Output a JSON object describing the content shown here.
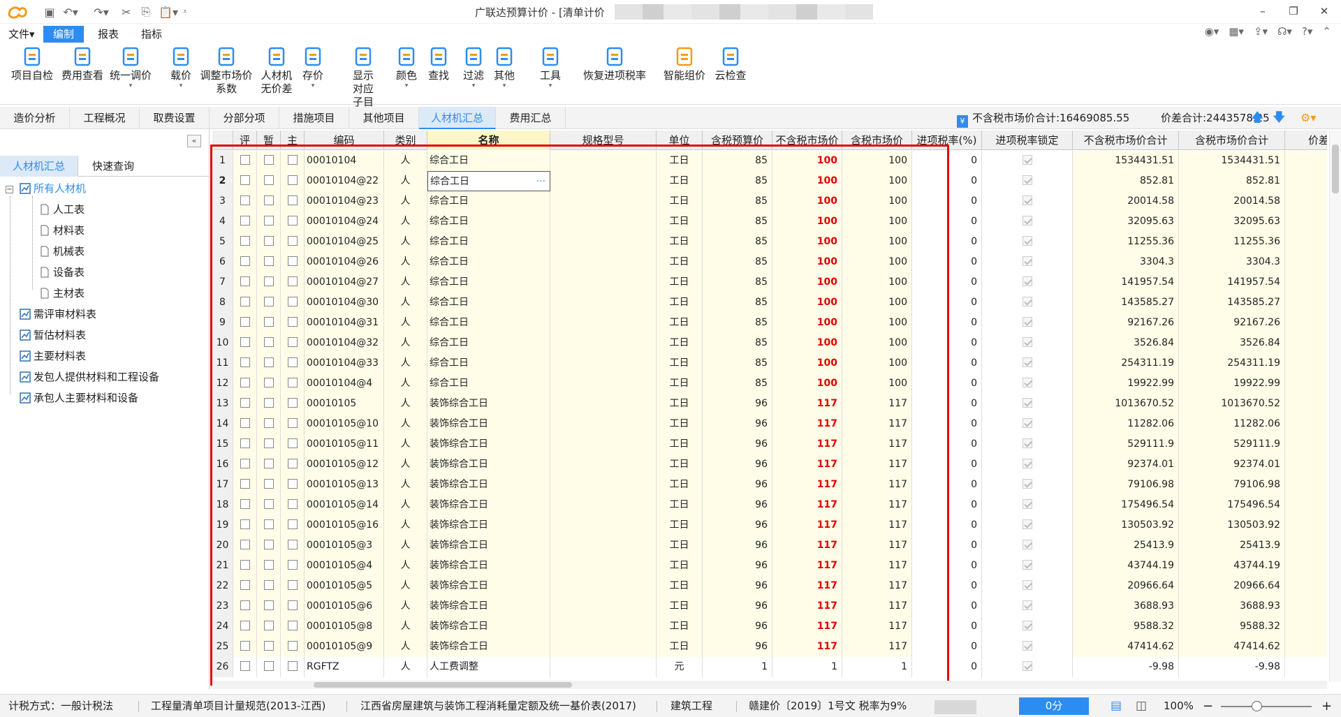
{
  "app": {
    "title": "广联达预算计价 - [清单计价"
  },
  "menu": [
    "文件",
    "编制",
    "报表",
    "指标"
  ],
  "ribbon": [
    {
      "label": "项目自检",
      "icon": "check-icon"
    },
    {
      "label": "费用查看",
      "icon": "cost-view-icon"
    },
    {
      "label": "统一调价",
      "icon": "adjust-price-icon"
    },
    {
      "label": "载价",
      "icon": "load-price-icon"
    },
    {
      "label": "调整市场价",
      "label2": "系数",
      "icon": "market-coef-icon"
    },
    {
      "label": "人材机",
      "label2": "无价差",
      "icon": "scale-icon"
    },
    {
      "label": "存价",
      "icon": "save-price-icon"
    },
    {
      "label": "显示",
      "label2": "对应子目",
      "icon": "show-sub-icon"
    },
    {
      "label": "颜色",
      "icon": "paint-icon"
    },
    {
      "label": "查找",
      "icon": "binoculars-icon"
    },
    {
      "label": "过滤",
      "icon": "filter-icon"
    },
    {
      "label": "其他",
      "icon": "grid-icon"
    },
    {
      "label": "工具",
      "icon": "tool-icon"
    },
    {
      "label": "恢复进项税率",
      "icon": "tax-rate-icon"
    },
    {
      "label": "智能组价",
      "icon": "smart-price-icon"
    },
    {
      "label": "云检查",
      "icon": "cloud-check-icon"
    }
  ],
  "tabs": [
    "造价分析",
    "工程概况",
    "取费设置",
    "分部分项",
    "措施项目",
    "其他项目",
    "人材机汇总",
    "费用汇总"
  ],
  "summary": {
    "no_tax_total": "不含税市场价合计:16469085.55",
    "diff_total": "价差合计:2443578.25"
  },
  "left": {
    "tabs": [
      "人材机汇总",
      "快速查询"
    ],
    "tree": [
      {
        "label": "所有人材机",
        "level": 0
      },
      {
        "label": "人工表",
        "level": 1
      },
      {
        "label": "材料表",
        "level": 1
      },
      {
        "label": "机械表",
        "level": 1
      },
      {
        "label": "设备表",
        "level": 1
      },
      {
        "label": "主材表",
        "level": 1
      },
      {
        "label": "需评审材料表",
        "level": 0
      },
      {
        "label": "暂估材料表",
        "level": 0
      },
      {
        "label": "主要材料表",
        "level": 0
      },
      {
        "label": "发包人提供材料和工程设备",
        "level": 0
      },
      {
        "label": "承包人主要材料和设备",
        "level": 0
      }
    ]
  },
  "grid": {
    "headers": [
      "",
      "评",
      "暂",
      "主",
      "编码",
      "类别",
      "名称",
      "规格型号",
      "单位",
      "含税预算价",
      "不含税市场价",
      "含税市场价",
      "进项税率(%)",
      "进项税率锁定",
      "不含税市场价合计",
      "含税市场价合计",
      "价差"
    ],
    "rows": [
      [
        "1",
        "00010104",
        "人",
        "综合工日",
        "工日",
        "85",
        "100",
        "100",
        "0",
        "1534431.51",
        "1534431.51"
      ],
      [
        "2",
        "00010104@22",
        "人",
        "综合工日",
        "工日",
        "85",
        "100",
        "100",
        "0",
        "852.81",
        "852.81"
      ],
      [
        "3",
        "00010104@23",
        "人",
        "综合工日",
        "工日",
        "85",
        "100",
        "100",
        "0",
        "20014.58",
        "20014.58"
      ],
      [
        "4",
        "00010104@24",
        "人",
        "综合工日",
        "工日",
        "85",
        "100",
        "100",
        "0",
        "32095.63",
        "32095.63"
      ],
      [
        "5",
        "00010104@25",
        "人",
        "综合工日",
        "工日",
        "85",
        "100",
        "100",
        "0",
        "11255.36",
        "11255.36"
      ],
      [
        "6",
        "00010104@26",
        "人",
        "综合工日",
        "工日",
        "85",
        "100",
        "100",
        "0",
        "3304.3",
        "3304.3"
      ],
      [
        "7",
        "00010104@27",
        "人",
        "综合工日",
        "工日",
        "85",
        "100",
        "100",
        "0",
        "141957.54",
        "141957.54"
      ],
      [
        "8",
        "00010104@30",
        "人",
        "综合工日",
        "工日",
        "85",
        "100",
        "100",
        "0",
        "143585.27",
        "143585.27"
      ],
      [
        "9",
        "00010104@31",
        "人",
        "综合工日",
        "工日",
        "85",
        "100",
        "100",
        "0",
        "92167.26",
        "92167.26"
      ],
      [
        "10",
        "00010104@32",
        "人",
        "综合工日",
        "工日",
        "85",
        "100",
        "100",
        "0",
        "3526.84",
        "3526.84"
      ],
      [
        "11",
        "00010104@33",
        "人",
        "综合工日",
        "工日",
        "85",
        "100",
        "100",
        "0",
        "254311.19",
        "254311.19"
      ],
      [
        "12",
        "00010104@4",
        "人",
        "综合工日",
        "工日",
        "85",
        "100",
        "100",
        "0",
        "19922.99",
        "19922.99"
      ],
      [
        "13",
        "00010105",
        "人",
        "装饰综合工日",
        "工日",
        "96",
        "117",
        "117",
        "0",
        "1013670.52",
        "1013670.52"
      ],
      [
        "14",
        "00010105@10",
        "人",
        "装饰综合工日",
        "工日",
        "96",
        "117",
        "117",
        "0",
        "11282.06",
        "11282.06"
      ],
      [
        "15",
        "00010105@11",
        "人",
        "装饰综合工日",
        "工日",
        "96",
        "117",
        "117",
        "0",
        "529111.9",
        "529111.9"
      ],
      [
        "16",
        "00010105@12",
        "人",
        "装饰综合工日",
        "工日",
        "96",
        "117",
        "117",
        "0",
        "92374.01",
        "92374.01"
      ],
      [
        "17",
        "00010105@13",
        "人",
        "装饰综合工日",
        "工日",
        "96",
        "117",
        "117",
        "0",
        "79106.98",
        "79106.98"
      ],
      [
        "18",
        "00010105@14",
        "人",
        "装饰综合工日",
        "工日",
        "96",
        "117",
        "117",
        "0",
        "175496.54",
        "175496.54"
      ],
      [
        "19",
        "00010105@16",
        "人",
        "装饰综合工日",
        "工日",
        "96",
        "117",
        "117",
        "0",
        "130503.92",
        "130503.92"
      ],
      [
        "20",
        "00010105@3",
        "人",
        "装饰综合工日",
        "工日",
        "96",
        "117",
        "117",
        "0",
        "25413.9",
        "25413.9"
      ],
      [
        "21",
        "00010105@4",
        "人",
        "装饰综合工日",
        "工日",
        "96",
        "117",
        "117",
        "0",
        "43744.19",
        "43744.19"
      ],
      [
        "22",
        "00010105@5",
        "人",
        "装饰综合工日",
        "工日",
        "96",
        "117",
        "117",
        "0",
        "20966.64",
        "20966.64"
      ],
      [
        "23",
        "00010105@6",
        "人",
        "装饰综合工日",
        "工日",
        "96",
        "117",
        "117",
        "0",
        "3688.93",
        "3688.93"
      ],
      [
        "24",
        "00010105@8",
        "人",
        "装饰综合工日",
        "工日",
        "96",
        "117",
        "117",
        "0",
        "9588.32",
        "9588.32"
      ],
      [
        "25",
        "00010105@9",
        "人",
        "装饰综合工日",
        "工日",
        "96",
        "117",
        "117",
        "0",
        "47414.62",
        "47414.62"
      ],
      [
        "26",
        "RGFTZ",
        "人",
        "人工费调整",
        "元",
        "1",
        "1",
        "1",
        "0",
        "-9.98",
        "-9.98"
      ]
    ]
  },
  "status": {
    "tax": "计税方式：一般计税法",
    "spec": "工程量清单项目计量规范(2013-江西)",
    "quota": "江西省房屋建筑与装饰工程消耗量定额及统一基价表(2017)",
    "type": "建筑工程",
    "doc": "赣建价〔2019〕1号文 税率为9%",
    "score": "0分",
    "zoom": "100%"
  }
}
